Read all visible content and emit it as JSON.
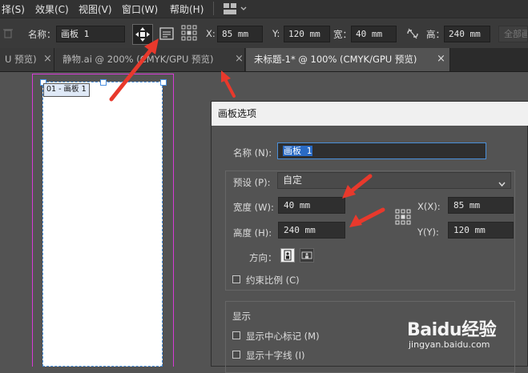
{
  "menubar": {
    "items": [
      "择(S)",
      "效果(C)",
      "视图(V)",
      "窗口(W)",
      "帮助(H)"
    ]
  },
  "control_bar": {
    "name_label": "名称：",
    "name_value": "画板 1",
    "x_label": "X:",
    "x_value": "85 mm",
    "y_label": "Y:",
    "y_value": "120 mm",
    "w_label": "宽：",
    "w_value": "40 mm",
    "h_label": "高：",
    "h_value": "240 mm",
    "rearrange_label": "全部画"
  },
  "tabs": [
    {
      "label": "U 预览)",
      "active": false
    },
    {
      "label": "静物.ai @ 200% (CMYK/GPU 预览)",
      "active": false
    },
    {
      "label": "未标题-1* @ 100% (CMYK/GPU 预览)",
      "active": true
    }
  ],
  "canvas": {
    "artboard_label": "01 - 画板 1"
  },
  "dialog": {
    "title": "画板选项",
    "name_label": "名称 (N):",
    "name_value": "画板 1",
    "preset_label": "预设 (P):",
    "preset_value": "自定",
    "width_label": "宽度 (W):",
    "width_value": "40 mm",
    "height_label": "高度 (H):",
    "height_value": "240 mm",
    "x_label": "X(X):",
    "x_value": "85 mm",
    "y_label": "Y(Y):",
    "y_value": "120 mm",
    "orientation_label": "方向：",
    "constrain_label": "约束比例 (C)",
    "display_label": "显示",
    "show_center_label": "显示中心标记 (M)",
    "show_cross_label": "显示十字线 (I)"
  },
  "watermark": {
    "brand": "Baidu经验",
    "url": "jingyan.baidu.com"
  },
  "colors": {
    "accent_arrow": "#e8392c",
    "artboard_border": "#d63ad6",
    "selection": "#4a90e2"
  }
}
